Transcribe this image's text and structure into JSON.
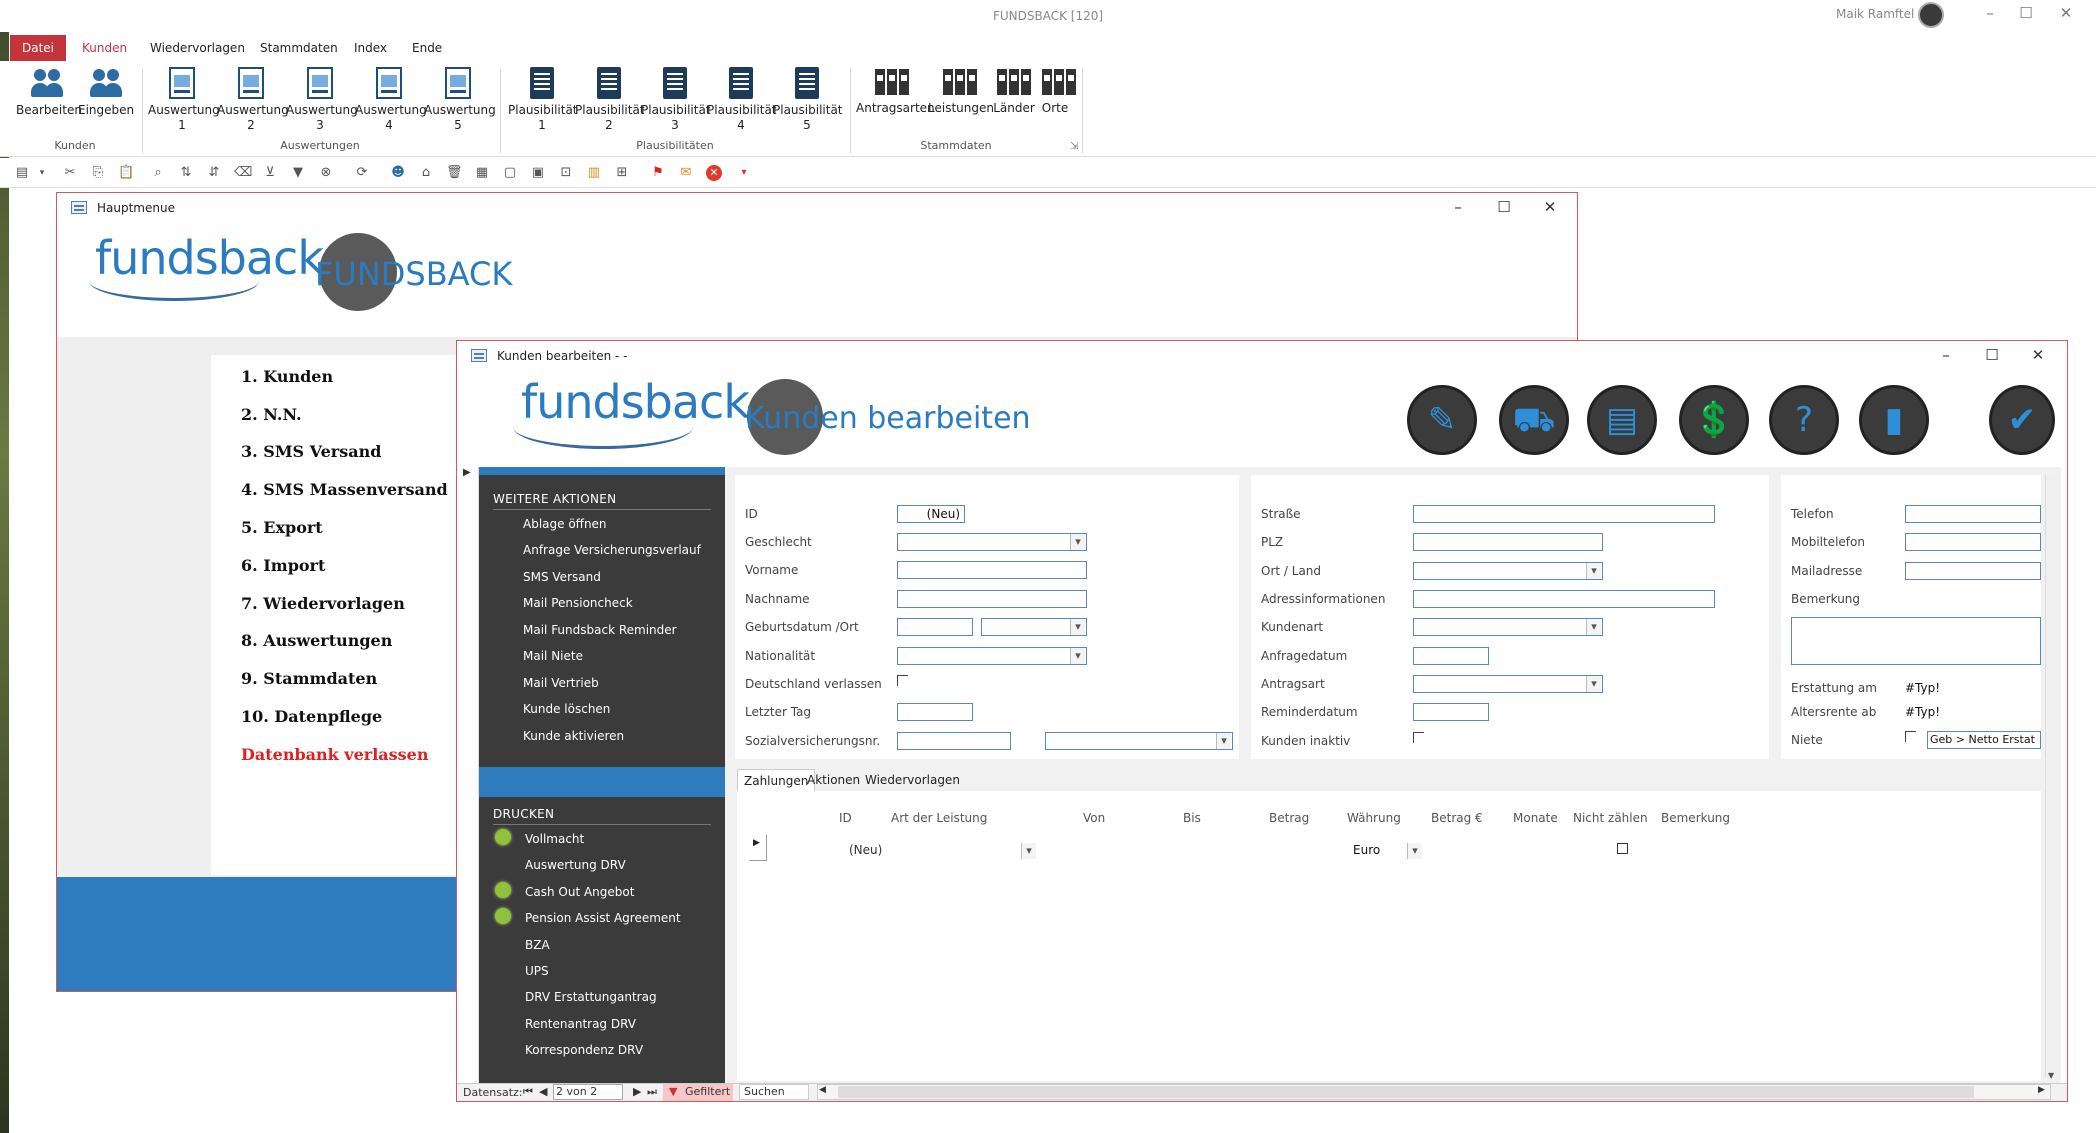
{
  "app": {
    "title": "FUNDSBACK [120]",
    "user": "Maik Ramftel"
  },
  "ribbon": {
    "tabs": [
      "Datei",
      "Kunden",
      "Wiedervorlagen",
      "Stammdaten",
      "Index",
      "Ende"
    ],
    "groups": {
      "kunden": {
        "label": "Kunden",
        "buttons": [
          "Bearbeiten",
          "Eingeben"
        ]
      },
      "auswertungen": {
        "label": "Auswertungen",
        "buttons": [
          {
            "line1": "Auswertung",
            "line2": "1"
          },
          {
            "line1": "Auswertung",
            "line2": "2"
          },
          {
            "line1": "Auswertung",
            "line2": "3"
          },
          {
            "line1": "Auswertung",
            "line2": "4"
          },
          {
            "line1": "Auswertung",
            "line2": "5"
          }
        ]
      },
      "plausibilitaeten": {
        "label": "Plausibilitäten",
        "buttons": [
          {
            "line1": "Plausibilität",
            "line2": "1"
          },
          {
            "line1": "Plausibilität",
            "line2": "2"
          },
          {
            "line1": "Plausibilität",
            "line2": "3"
          },
          {
            "line1": "Plausibilität",
            "line2": "4"
          },
          {
            "line1": "Plausibilität",
            "line2": "5"
          }
        ]
      },
      "stammdaten": {
        "label": "Stammdaten",
        "buttons": [
          "Antragsarten",
          "Leistungen",
          "Länder",
          "Orte"
        ]
      }
    }
  },
  "hauptmenue": {
    "title": "Hauptmenue",
    "logo_text": "fundsback",
    "brand_text": "FUNDSBACK",
    "menu": [
      "1. Kunden",
      "2. N.N.",
      "3. SMS Versand",
      "4. SMS Massenversand",
      "5. Export",
      "6. Import",
      "7. Wiedervorlagen",
      "8. Auswertungen",
      "9. Stammdaten",
      "10. Datenpflege"
    ],
    "exit": "Datenbank verlassen"
  },
  "kunden": {
    "window_title": "Kunden bearbeiten -  -",
    "logo_text": "fundsback",
    "heading": "Kunden bearbeiten",
    "weitere_aktionen": {
      "heading": "WEITERE AKTIONEN",
      "items": [
        "Ablage öffnen",
        "Anfrage Versicherungsverlauf",
        "SMS Versand",
        "Mail Pensioncheck",
        "Mail Fundsback Reminder",
        "Mail Niete",
        "Mail Vertrieb",
        "Kunde löschen",
        "Kunde aktivieren"
      ]
    },
    "drucken": {
      "heading": "DRUCKEN",
      "items": [
        {
          "label": "Vollmacht",
          "bulb": true
        },
        {
          "label": "Auswertung DRV",
          "bulb": false
        },
        {
          "label": "Cash Out Angebot",
          "bulb": true
        },
        {
          "label": "Pension Assist Agreement",
          "bulb": true
        },
        {
          "label": "BZA",
          "bulb": false
        },
        {
          "label": "UPS",
          "bulb": false
        },
        {
          "label": "DRV Erstattungantrag",
          "bulb": false
        },
        {
          "label": "Rentenantrag DRV",
          "bulb": false
        },
        {
          "label": "Korrespondenz DRV",
          "bulb": false
        }
      ]
    },
    "form1": {
      "id_label": "ID",
      "id_value": "(Neu)",
      "geschlecht": "Geschlecht",
      "vorname": "Vorname",
      "nachname": "Nachname",
      "geburt": "Geburtsdatum /Ort",
      "nationalitaet": "Nationalität",
      "deutschland": "Deutschland verlassen",
      "letzter_tag": "Letzter Tag",
      "sv_nr": "Sozialversicherungsnr."
    },
    "form2": {
      "strasse": "Straße",
      "plz": "PLZ",
      "ort_land": "Ort / Land",
      "adressinfo": "Adressinformationen",
      "kundenart": "Kundenart",
      "anfragedatum": "Anfragedatum",
      "antragsart": "Antragsart",
      "reminderdatum": "Reminderdatum",
      "inaktiv": "Kunden inaktiv"
    },
    "form3": {
      "telefon": "Telefon",
      "mobiltelefon": "Mobiltelefon",
      "mailadresse": "Mailadresse",
      "bemerkung": "Bemerkung",
      "erstattung": "Erstattung am",
      "erstattung_val": "#Typ!",
      "altersrente": "Altersrente ab",
      "altersrente_val": "#Typ!",
      "niete": "Niete",
      "niete_combo": "Geb > Netto Erstat"
    },
    "subtabs": [
      "Zahlungen",
      "Aktionen",
      "Wiedervorlagen"
    ],
    "grid": {
      "columns": [
        "ID",
        "Art der Leistung",
        "Von",
        "Bis",
        "Betrag",
        "Währung",
        "Betrag €",
        "Monate",
        "Nicht zählen",
        "Bemerkung"
      ],
      "new_row": {
        "id": "(Neu)",
        "waehrung": "Euro"
      }
    },
    "nav": {
      "label": "Datensatz:",
      "position": "2 von 2",
      "filter": "Gefiltert",
      "search": "Suchen"
    }
  },
  "colors": {
    "accent_red": "#c6343b",
    "brand_blue": "#2e7cbd",
    "sidebar_dark": "#3b3b3b",
    "exit_red": "#e02020"
  }
}
